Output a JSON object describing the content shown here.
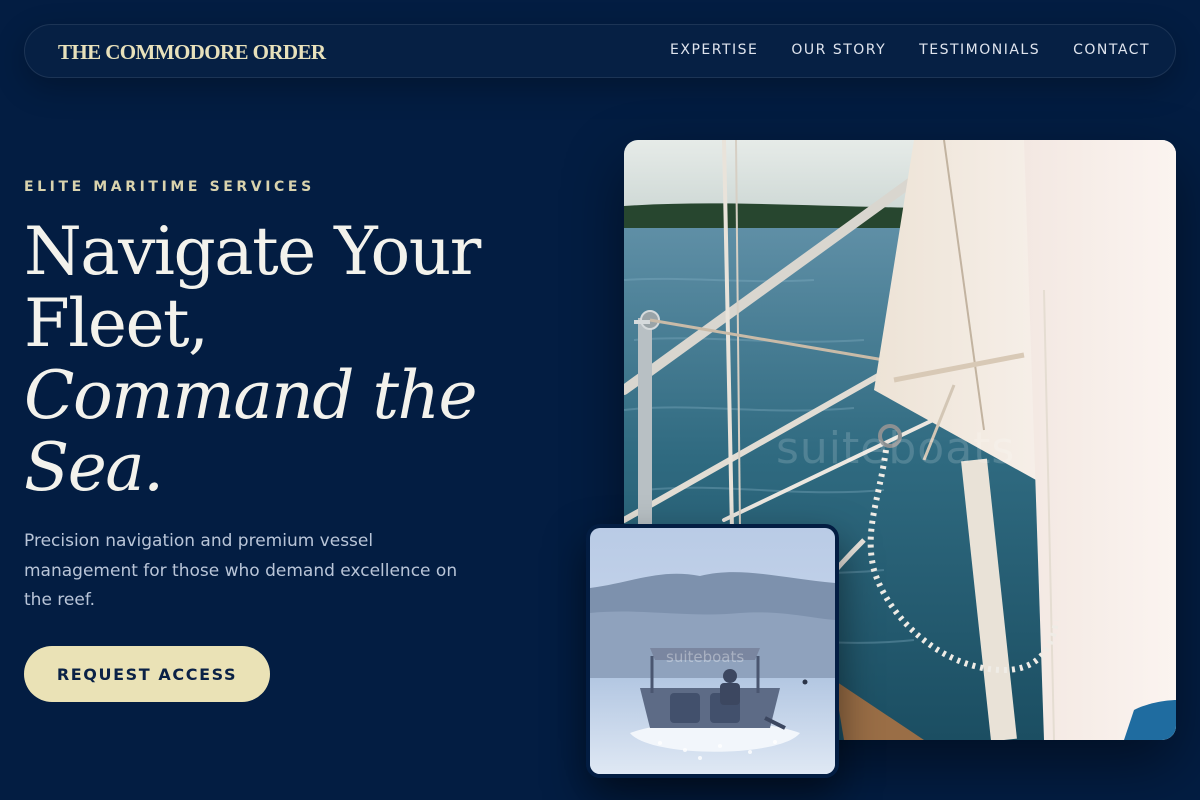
{
  "nav": {
    "brand": "THE COMMODORE ORDER",
    "links": [
      "EXPERTISE",
      "OUR STORY",
      "TESTIMONIALS",
      "CONTACT"
    ]
  },
  "hero": {
    "eyebrow": "ELITE MARITIME SERVICES",
    "headline_lines": [
      "Navigate Your",
      "Fleet,"
    ],
    "headline_italic_lines": [
      "Command the",
      "Sea."
    ],
    "description": "Precision navigation and premium vessel management for those who demand excellence on the reef.",
    "cta_label": "REQUEST ACCESS"
  },
  "images": {
    "main_watermark": "suiteboats",
    "inset_watermark": "suiteboats"
  },
  "colors": {
    "background": "#031d42",
    "brand": "#e8e1bb",
    "cta_background": "#eae2b6",
    "cta_text": "#0a2146",
    "body_text": "#b9c5d8"
  }
}
